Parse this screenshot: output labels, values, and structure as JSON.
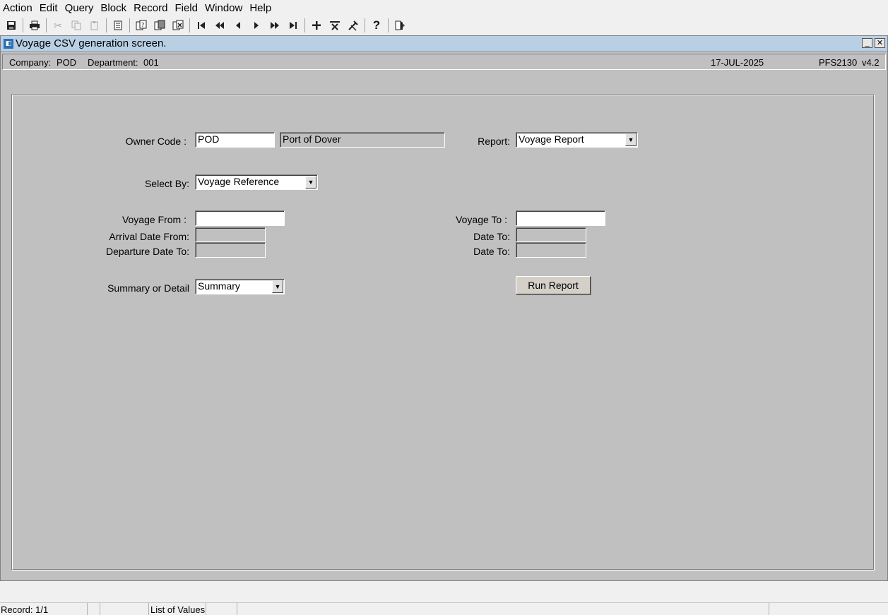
{
  "menu": [
    {
      "label": "Action"
    },
    {
      "label": "Edit"
    },
    {
      "label": "Query"
    },
    {
      "label": "Block"
    },
    {
      "label": "Record"
    },
    {
      "label": "Field"
    },
    {
      "label": "Window"
    },
    {
      "label": "Help"
    }
  ],
  "window": {
    "title": "Voyage CSV generation screen.",
    "minimize": "_",
    "close": "✕"
  },
  "info": {
    "company_label": "Company:",
    "company_value": "POD",
    "department_label": "Department:",
    "department_value": "001",
    "date": "17-JUL-2025",
    "program": "PFS2130",
    "version": "v4.2"
  },
  "form": {
    "owner_code_label": "Owner Code :",
    "owner_code_value": "POD",
    "owner_name_value": "Port of Dover",
    "report_label": "Report:",
    "report_value": "Voyage Report",
    "select_by_label": "Select By:",
    "select_by_value": "Voyage Reference",
    "voyage_from_label": "Voyage From :",
    "voyage_from_value": "",
    "voyage_to_label": "Voyage To :",
    "voyage_to_value": "",
    "arrival_from_label": "Arrival Date From:",
    "arrival_to_label": "Date To:",
    "departure_to_label": "Departure Date To:",
    "departure_date_to_label": "Date To:",
    "summary_label": "Summary or Detail",
    "summary_value": "Summary",
    "run_report_label": "Run Report"
  },
  "status": {
    "record": "Record: 1/1",
    "lov": "List of Values"
  }
}
